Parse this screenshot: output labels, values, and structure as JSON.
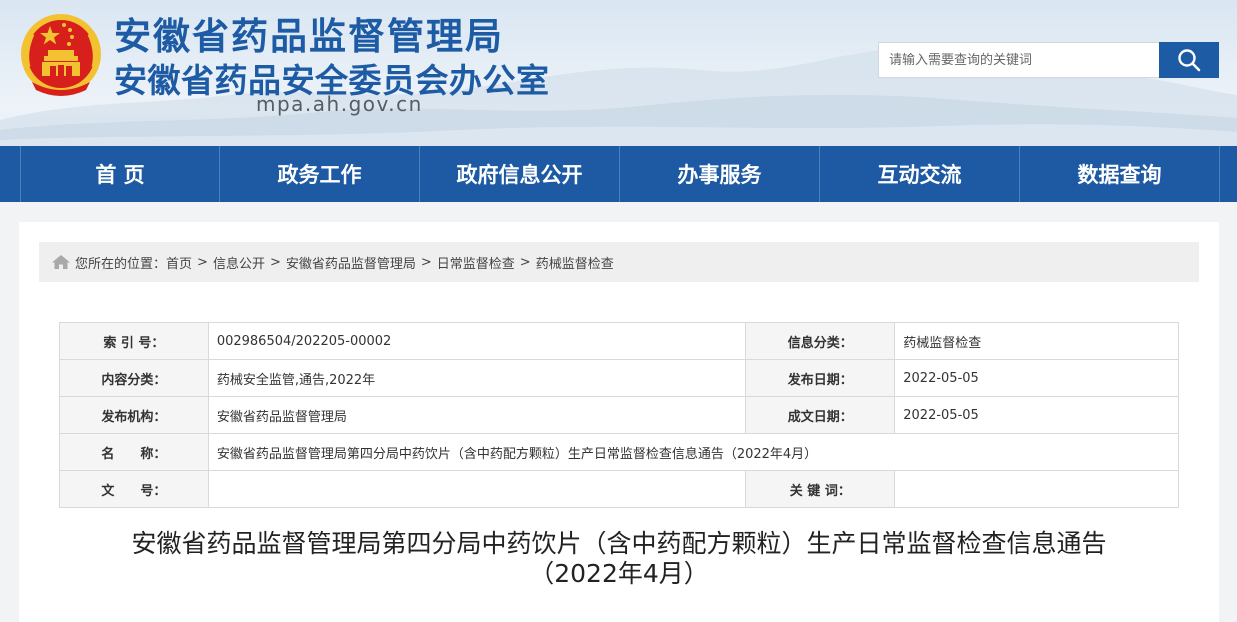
{
  "header": {
    "title": "安徽省药品监督管理局",
    "subtitle": "安徽省药品安全委员会办公室",
    "domain": "mpa.ah.gov.cn",
    "emblem_icon": "national-emblem-icon"
  },
  "search": {
    "placeholder": "请输入需要查询的关键词",
    "button_icon": "search-icon"
  },
  "nav": {
    "items": [
      "首 页",
      "政务工作",
      "政府信息公开",
      "办事服务",
      "互动交流",
      "数据查询"
    ]
  },
  "breadcrumb": {
    "prefix": "您所在的位置：",
    "items": [
      "首页",
      "信息公开",
      "安徽省药品监督管理局",
      "日常监督检查",
      "药械监督检查"
    ],
    "separator": ">",
    "icon": "home-icon"
  },
  "info_table": {
    "index_label": "索 引 号：",
    "index_value": "002986504/202205-00002",
    "category_label": "信息分类：",
    "category_value": "药械监督检查",
    "content_label": "内容分类：",
    "content_value": "药械安全监管,通告,2022年",
    "pubdate_label": "发布日期：",
    "pubdate_value": "2022-05-05",
    "org_label": "发布机构：",
    "org_value": "安徽省药品监督管理局",
    "created_label": "成文日期：",
    "created_value": "2022-05-05",
    "name_label": "名　　称：",
    "name_value": "安徽省药品监督管理局第四分局中药饮片（含中药配方颗粒）生产日常监督检查信息通告（2022年4月）",
    "docno_label": "文　　号：",
    "docno_value": "",
    "keywords_label": "关 键 词：",
    "keywords_value": ""
  },
  "article": {
    "title_line1": "安徽省药品监督管理局第四分局中药饮片（含中药配方颗粒）生产日常监督检查信息通告",
    "title_line2": "（2022年4月）"
  },
  "colors": {
    "brand_blue": "#1d5ba5",
    "nav_blue": "#1d5aa3",
    "emblem_red": "#d7201c",
    "emblem_gold": "#f2c230"
  }
}
